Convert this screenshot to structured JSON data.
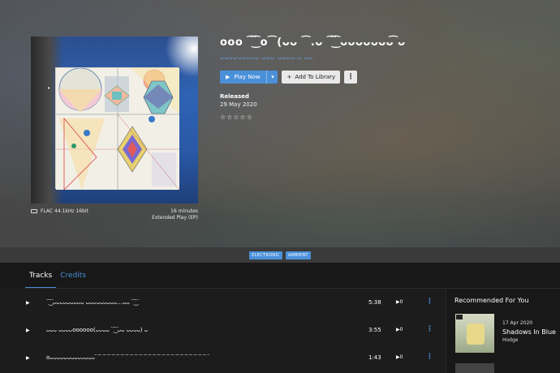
{
  "album": {
    "title": "ooo ⁀͜͡ o⁀(ᴗᴗ ⁀.ᴗ ⁀͜͡ ᴗᴗᴗᴗᴗᴗᴗ͡ ᴗ",
    "artist": "ᴗᴗᴗᴗᴗᴗᴗᴗᴗ ᴗᴗᴗ ᴗᴗᴗᴗ.ᴗ ᴗᴗ",
    "format": "FLAC 44.1kHz 16bit",
    "length": "16 minutes",
    "release_type": "Extended Play (EP)",
    "released_label": "Released",
    "released_date": "29 May 2020",
    "rating_stars": "☆☆☆☆☆",
    "cover_lights": "• • • • •"
  },
  "actions": {
    "play_now": "Play Now",
    "add_to_library": "Add To Library",
    "play_icon": "▶",
    "caret_icon": "▾",
    "plus_icon": "+",
    "more_icon": "⋮"
  },
  "genres": [
    "ELECTRONIC",
    "AMBIENT"
  ],
  "tabs": {
    "tracks": "Tracks",
    "credits": "Credits"
  },
  "tracks": [
    {
      "name": "⁀͜͡ ᴗᴗᴗᴗᴗᴗᴗᴗᴗ ᴗᴗᴗᴗᴗᴗᴗᴗᴗ…ᴗᴗ ⁀͜͡",
      "duration": "5:38",
      "plays": "0"
    },
    {
      "name": "ᴗᴗᴗ ᴗᴗᴗᴗoooooo(ᴗᴗᴗᴗ ⁀͜͡ ᴗᴗ ᴗᴗᴗᴗ) ᴗ",
      "duration": "3:55",
      "plays": "0"
    },
    {
      "name": "oᴗᴗᴗᴗᴗᴗᴗᴗᴗᴗᴗᴗᴗ⁀⁀⁀⁀⁀⁀⁀⁀⁀⁀⁀⁀⁀⁀⁀⁀⁀⁀⁀⁀⁀⁀⁀⁀⁀",
      "duration": "1:43",
      "plays": "0"
    }
  ],
  "track_icons": {
    "play": "▶",
    "plays_icon": "▶",
    "kebab": "⋮"
  },
  "recommended": {
    "heading": "Recommended For You",
    "items": [
      {
        "date": "17 Apr 2020",
        "title": "Shadows In Blue",
        "artist": "Hodge"
      }
    ]
  },
  "colors": {
    "accent": "#4a90d9",
    "background": "#181818"
  }
}
